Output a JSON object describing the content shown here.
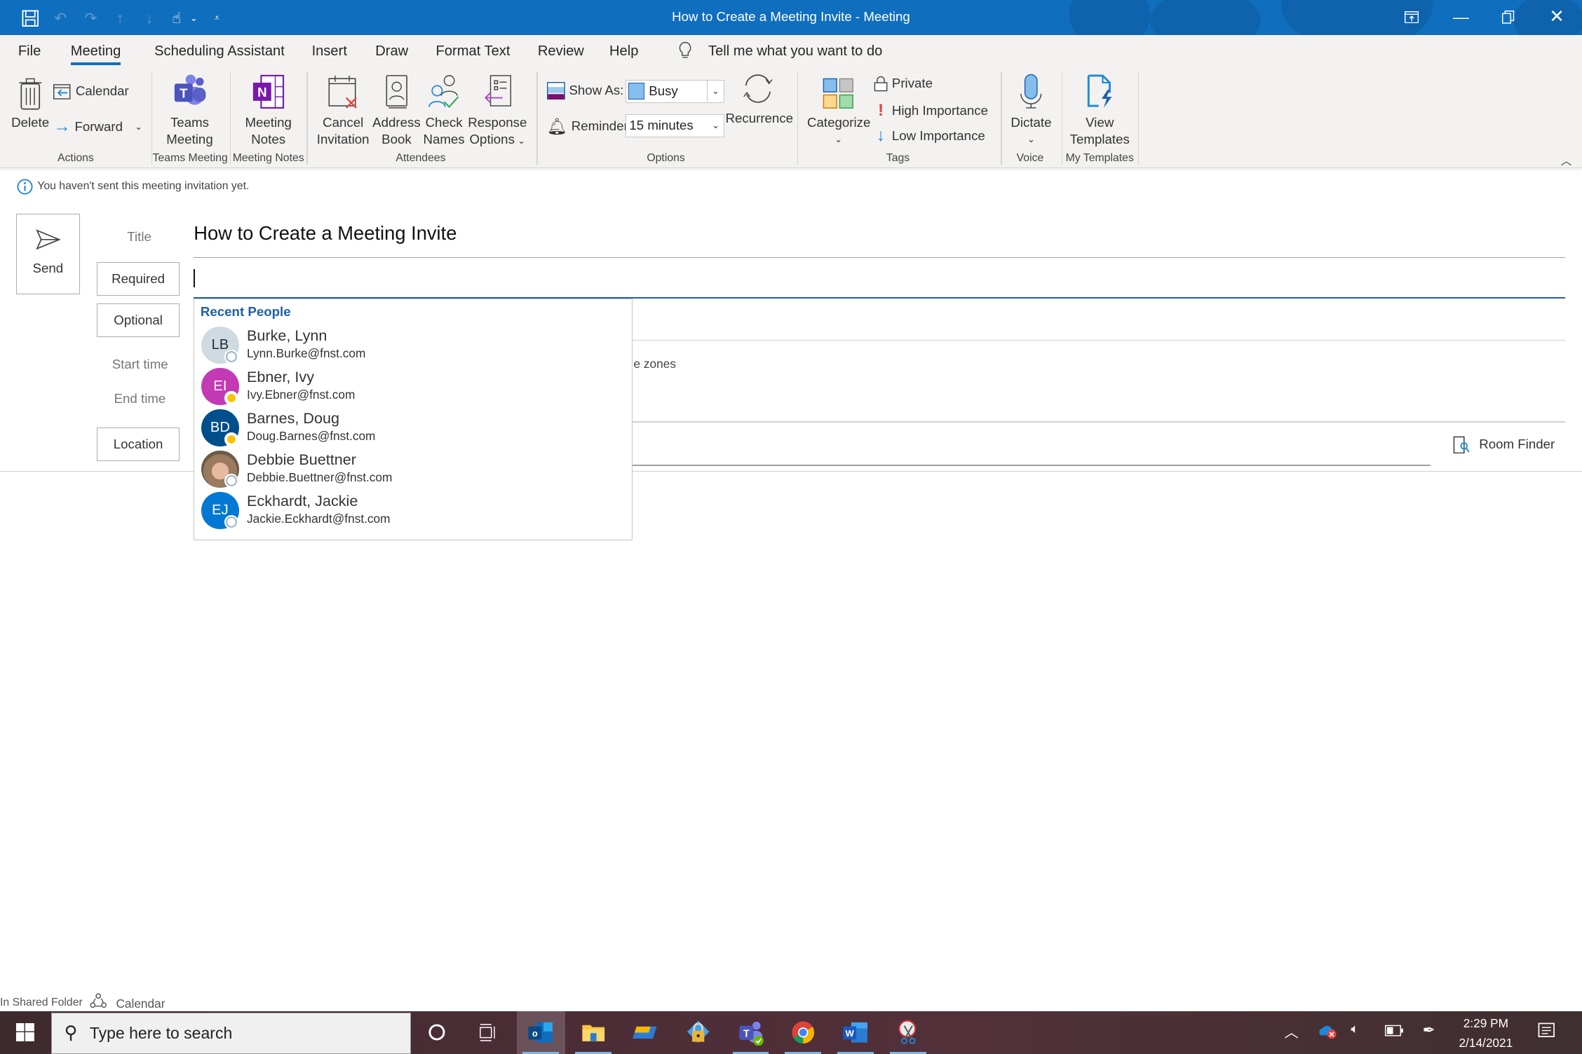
{
  "window": {
    "title": "How to Create a Meeting Invite  -  Meeting",
    "controls": [
      "ribbon-display-options",
      "minimize",
      "restore",
      "close"
    ]
  },
  "quick_access": {
    "items": [
      "save",
      "undo",
      "redo",
      "previous-item",
      "next-item",
      "touch-mouse-mode",
      "customize"
    ]
  },
  "ribbon": {
    "tabs": [
      "File",
      "Meeting",
      "Scheduling Assistant",
      "Insert",
      "Draw",
      "Format Text",
      "Review",
      "Help"
    ],
    "active_tab": "Meeting",
    "tell_me": "Tell me what you want to do",
    "groups": {
      "actions": {
        "label": "Actions",
        "delete": "Delete",
        "calendar": "Calendar",
        "forward": "Forward"
      },
      "teams": {
        "label": "Teams Meeting",
        "button_line1": "Teams",
        "button_line2": "Meeting"
      },
      "notes": {
        "label": "Meeting Notes",
        "button_line1": "Meeting",
        "button_line2": "Notes"
      },
      "attendees": {
        "label": "Attendees",
        "cancel_line1": "Cancel",
        "cancel_line2": "Invitation",
        "address_line1": "Address",
        "address_line2": "Book",
        "check_line1": "Check",
        "check_line2": "Names",
        "response_line1": "Response",
        "response_line2": "Options"
      },
      "options": {
        "label": "Options",
        "show_as_label": "Show As:",
        "show_as_value": "Busy",
        "reminder_label": "Reminder:",
        "reminder_value": "15 minutes",
        "recurrence": "Recurrence"
      },
      "tags": {
        "label": "Tags",
        "categorize": "Categorize",
        "private": "Private",
        "high": "High Importance",
        "low": "Low Importance"
      },
      "voice": {
        "label": "Voice",
        "dictate": "Dictate"
      },
      "templates": {
        "label": "My Templates",
        "line1": "View",
        "line2": "Templates"
      }
    }
  },
  "info_bar": "You haven't sent this meeting invitation yet.",
  "form": {
    "send": "Send",
    "title_label": "Title",
    "title_value": "How to Create a Meeting Invite",
    "required": "Required",
    "required_value": "",
    "optional": "Optional",
    "start_time": "Start time",
    "end_time": "End time",
    "time_zones_fragment": "e zones",
    "location": "Location",
    "room_finder": "Room Finder"
  },
  "suggestions": {
    "header": "Recent People",
    "people": [
      {
        "name": "Burke, Lynn",
        "email": "Lynn.Burke@fnst.com",
        "initials": "LB",
        "color": "#d0dbe1",
        "text_color": "#1f2d3a",
        "presence": "offline"
      },
      {
        "name": "Ebner, Ivy",
        "email": "Ivy.Ebner@fnst.com",
        "initials": "EI",
        "color": "#c43ab5",
        "text_color": "#ffffff",
        "presence": "away"
      },
      {
        "name": "Barnes, Doug",
        "email": "Doug.Barnes@fnst.com",
        "initials": "BD",
        "color": "#004e8c",
        "text_color": "#ffffff",
        "presence": "away"
      },
      {
        "name": "Debbie Buettner",
        "email": "Debbie.Buettner@fnst.com",
        "initials": "",
        "color": "#8a7560",
        "text_color": "#ffffff",
        "presence": "offline"
      },
      {
        "name": "Eckhardt, Jackie",
        "email": "Jackie.Eckhardt@fnst.com",
        "initials": "EJ",
        "color": "#0078d4",
        "text_color": "#ffffff",
        "presence": "offline"
      }
    ]
  },
  "status_bar": {
    "folder": "In Shared Folder",
    "calendar": "Calendar"
  },
  "taskbar": {
    "search_placeholder": "Type here to search",
    "time": "2:29 PM",
    "date": "2/14/2021",
    "apps": [
      "cortana",
      "task-view",
      "outlook",
      "file-explorer",
      "app-yellow",
      "security-lock",
      "teams",
      "chrome",
      "word",
      "snipping-tool"
    ]
  },
  "colors": {
    "accent": "#106ebe",
    "link_blue": "#1e5fa8",
    "ribbon_bg": "#f3f2f1"
  }
}
